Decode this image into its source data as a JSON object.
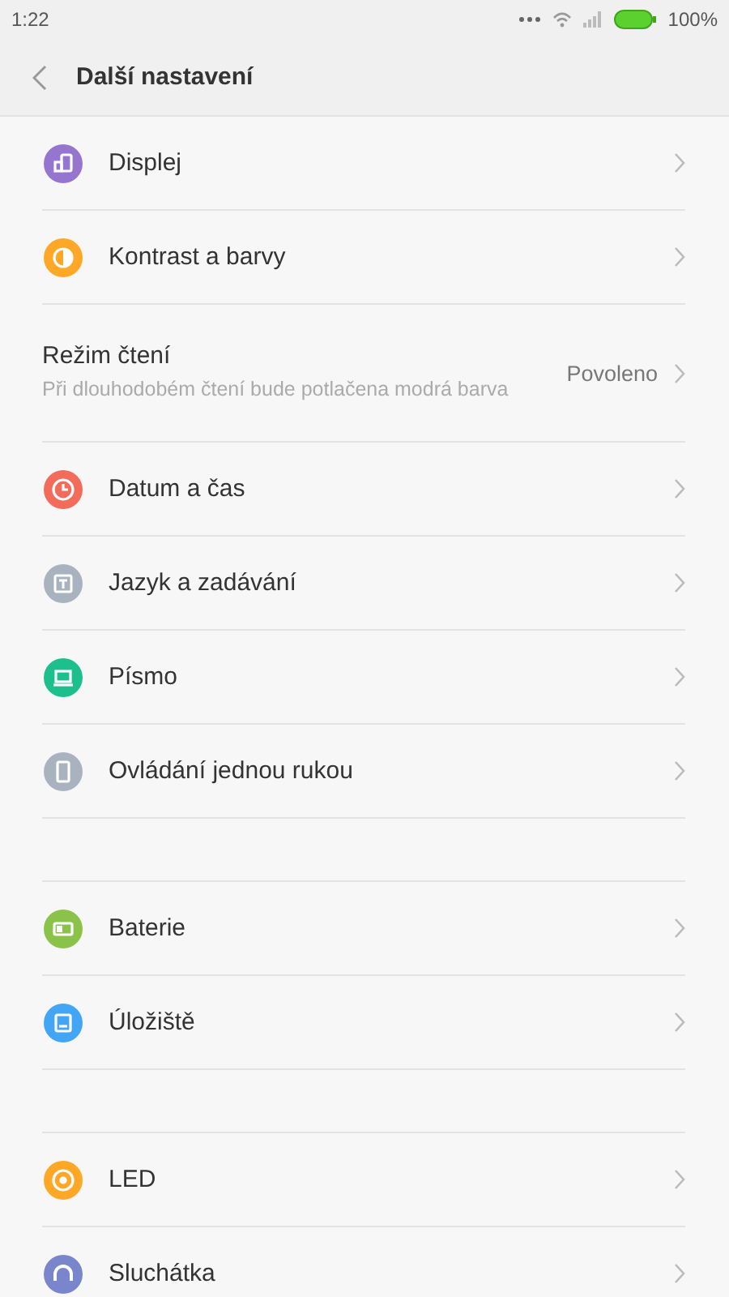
{
  "status_bar": {
    "time": "1:22",
    "battery": "100%"
  },
  "header": {
    "title": "Další nastavení"
  },
  "groups": [
    {
      "items": [
        {
          "kind": "icon",
          "label": "Displej",
          "color": "#9575cd"
        },
        {
          "kind": "icon",
          "label": "Kontrast a barvy",
          "color": "#ffa726"
        },
        {
          "kind": "text",
          "label": "Režim čtení",
          "hint": "Při dlouhodobém čtení bude potlačena modrá barva",
          "value": "Povoleno"
        },
        {
          "kind": "icon",
          "label": "Datum a čas",
          "color": "#f26b5b"
        },
        {
          "kind": "icon",
          "label": "Jazyk a zadávání",
          "color": "#a9b3bf"
        },
        {
          "kind": "icon",
          "label": "Písmo",
          "color": "#1dbf8c"
        },
        {
          "kind": "icon",
          "label": "Ovládání jednou rukou",
          "color": "#a9b3bf"
        }
      ]
    },
    {
      "items": [
        {
          "kind": "icon",
          "label": "Baterie",
          "color": "#8bc34a"
        },
        {
          "kind": "icon",
          "label": "Úložiště",
          "color": "#42a5f5"
        }
      ]
    },
    {
      "items": [
        {
          "kind": "icon",
          "label": "LED",
          "color": "#ffa726"
        },
        {
          "kind": "icon",
          "label": "Sluchátka",
          "color": "#7986cb"
        }
      ]
    }
  ]
}
